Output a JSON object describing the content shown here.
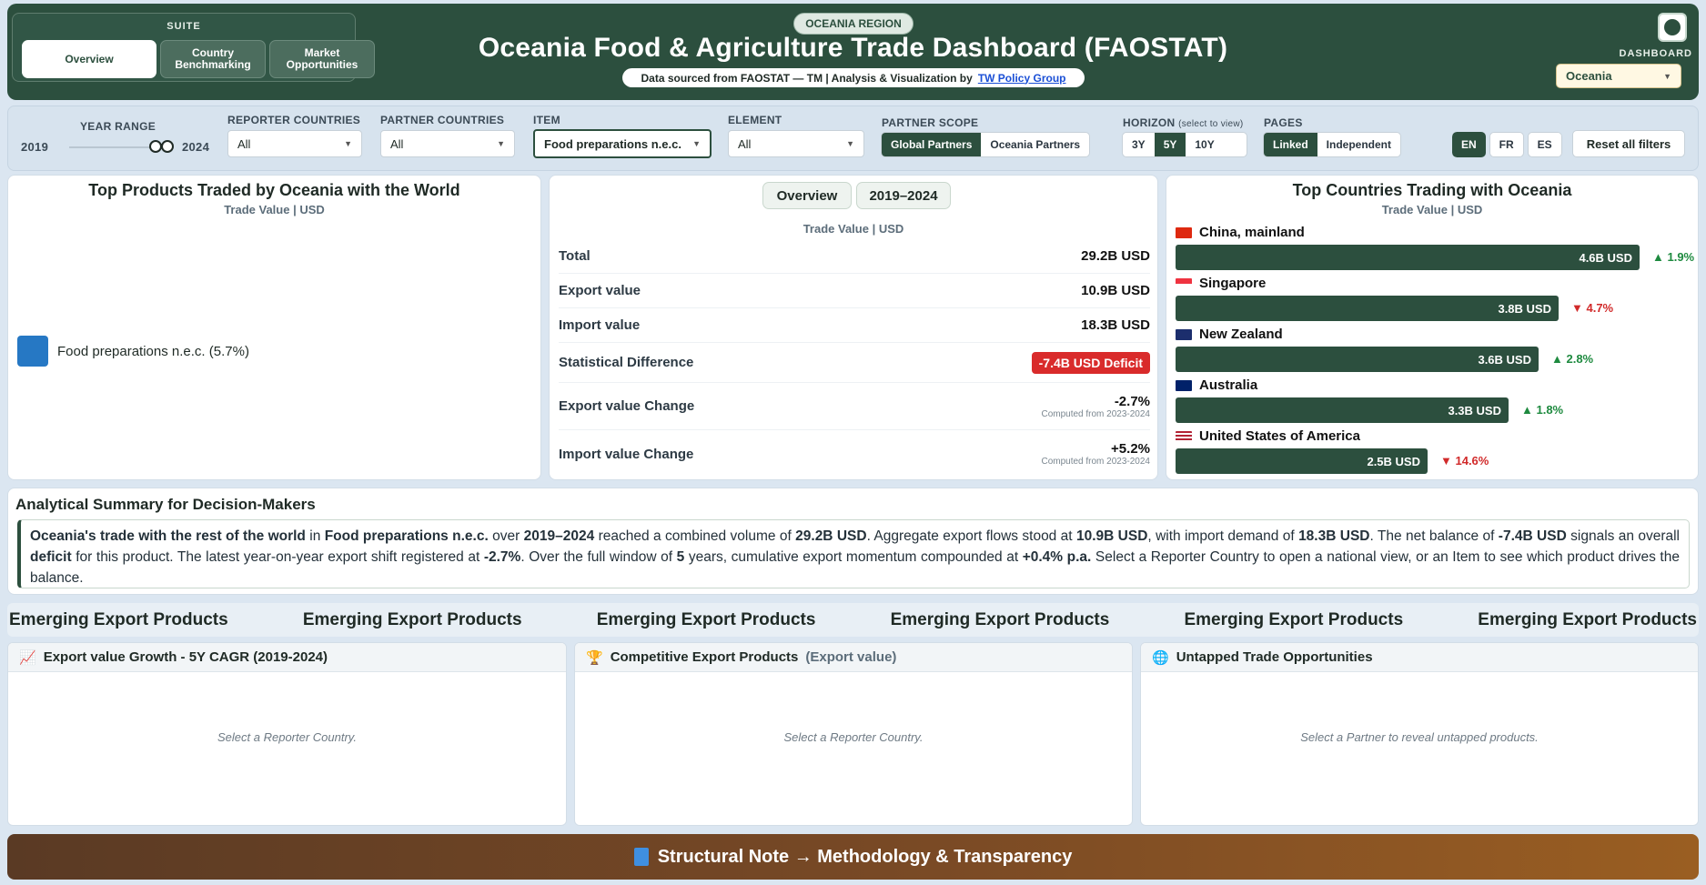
{
  "header": {
    "suite_label": "SUITE",
    "suite_tabs": [
      "Overview",
      "Country Benchmarking",
      "Market Opportunities"
    ],
    "region_badge": "OCEANIA REGION",
    "title": "Oceania Food & Agriculture Trade Dashboard (FAOSTAT)",
    "source_text": "Data sourced from FAOSTAT — TM | Analysis & Visualization by",
    "source_link": "TW Policy Group",
    "dashboard_label": "DASHBOARD",
    "dashboard_value": "Oceania",
    "logo_icon": "globe-logo-icon"
  },
  "filters": {
    "year_range_label": "YEAR RANGE",
    "year_start": "2019",
    "year_end": "2024",
    "reporter_label": "REPORTER COUNTRIES",
    "reporter_value": "All",
    "partner_label": "PARTNER COUNTRIES",
    "partner_value": "All",
    "item_label": "ITEM",
    "item_value": "Food preparations n.e.c.",
    "element_label": "ELEMENT",
    "element_value": "All",
    "scope_label": "PARTNER SCOPE",
    "scope_options": [
      "Global Partners",
      "Oceania Partners"
    ],
    "horizon_label": "HORIZON",
    "horizon_hint": "(select to view)",
    "horizon_options": [
      "3Y",
      "5Y",
      "10Y"
    ],
    "pages_label": "PAGES",
    "pages_options": [
      "Linked",
      "Independent"
    ],
    "languages": [
      "EN",
      "FR",
      "ES"
    ],
    "reset_label": "Reset all filters"
  },
  "products_panel": {
    "title": "Top Products Traded by Oceania with the World",
    "subtitle": "Trade Value | USD",
    "legend": [
      {
        "label": "Food preparations n.e.c. (5.7%)",
        "color": "#2678c4"
      }
    ]
  },
  "stats_panel": {
    "tabs": [
      "Overview",
      "2019–2024"
    ],
    "subtitle": "Trade Value | USD",
    "rows": [
      {
        "label": "Total",
        "value": "29.2B USD"
      },
      {
        "label": "Export value",
        "value": "10.9B USD"
      },
      {
        "label": "Import value",
        "value": "18.3B USD"
      },
      {
        "label": "Statistical Difference",
        "value": "-7.4B USD Deficit"
      },
      {
        "label": "Export value Change",
        "value": "-2.7%",
        "note": "Computed from 2023-2024"
      },
      {
        "label": "Import value Change",
        "value": "+5.2%",
        "note": "Computed from 2023-2024"
      }
    ]
  },
  "countries_panel": {
    "title": "Top Countries Trading with Oceania",
    "subtitle": "Trade Value | USD",
    "countries": [
      {
        "name": "China, mainland",
        "value": "4.6B USD",
        "value_num": 4.6,
        "change": "▲ 1.9%",
        "dir": "up"
      },
      {
        "name": "Singapore",
        "value": "3.8B USD",
        "value_num": 3.8,
        "change": "▼ 4.7%",
        "dir": "down"
      },
      {
        "name": "New Zealand",
        "value": "3.6B USD",
        "value_num": 3.6,
        "change": "▲ 2.8%",
        "dir": "up"
      },
      {
        "name": "Australia",
        "value": "3.3B USD",
        "value_num": 3.3,
        "change": "▲ 1.8%",
        "dir": "up"
      },
      {
        "name": "United States of America",
        "value": "2.5B USD",
        "value_num": 2.5,
        "change": "▼ 14.6%",
        "dir": "down"
      }
    ]
  },
  "summary": {
    "title": "Analytical Summary for Decision-Makers",
    "parts": [
      {
        "t": "Oceania's trade with the rest of the world",
        "b": true
      },
      {
        "t": " in ",
        "b": false
      },
      {
        "t": "Food preparations n.e.c.",
        "b": true
      },
      {
        "t": " over ",
        "b": false
      },
      {
        "t": "2019–2024",
        "b": true
      },
      {
        "t": " reached a combined volume of ",
        "b": false
      },
      {
        "t": "29.2B USD",
        "b": true
      },
      {
        "t": ". Aggregate export flows stood at ",
        "b": false
      },
      {
        "t": "10.9B USD",
        "b": true
      },
      {
        "t": ", with import demand of ",
        "b": false
      },
      {
        "t": "18.3B USD",
        "b": true
      },
      {
        "t": ". The net balance of ",
        "b": false
      },
      {
        "t": "-7.4B USD",
        "b": true
      },
      {
        "t": " signals an overall ",
        "b": false
      },
      {
        "t": "deficit",
        "b": true
      },
      {
        "t": " for this product. The latest year-on-year export shift registered at ",
        "b": false
      },
      {
        "t": "-2.7%",
        "b": true
      },
      {
        "t": ". Over the full window of ",
        "b": false
      },
      {
        "t": "5",
        "b": true
      },
      {
        "t": " years, cumulative export momentum compounded at ",
        "b": false
      },
      {
        "t": "+0.4% p.a.",
        "b": true
      },
      {
        "t": " Select a Reporter Country to open a national view, or an Item to see which product drives the balance.",
        "b": false
      }
    ]
  },
  "emerging": {
    "label": "Emerging Export Products",
    "repeat": 6
  },
  "cards": [
    {
      "icon": "📈",
      "icon_name": "chart-up-icon",
      "title": "Export value Growth - 5Y CAGR (2019-2024)",
      "suffix": "",
      "empty": "Select a Reporter Country."
    },
    {
      "icon": "🏆",
      "icon_name": "trophy-icon",
      "title": "Competitive Export Products",
      "suffix": "(Export value)",
      "empty": "Select a Reporter Country."
    },
    {
      "icon": "🌐",
      "icon_name": "globe-icon",
      "title": "Untapped Trade Opportunities",
      "suffix": "",
      "empty": "Select a Partner to reveal untapped products."
    }
  ],
  "footer": {
    "label": "Structural Note → Methodology & Transparency",
    "icon_name": "book-icon"
  },
  "colors": {
    "brand": "#2c4f3e",
    "bar": "#2c4f3e",
    "positive": "#1e8a3f",
    "negative": "#d12a2a",
    "deficit": "#d92b2b"
  }
}
